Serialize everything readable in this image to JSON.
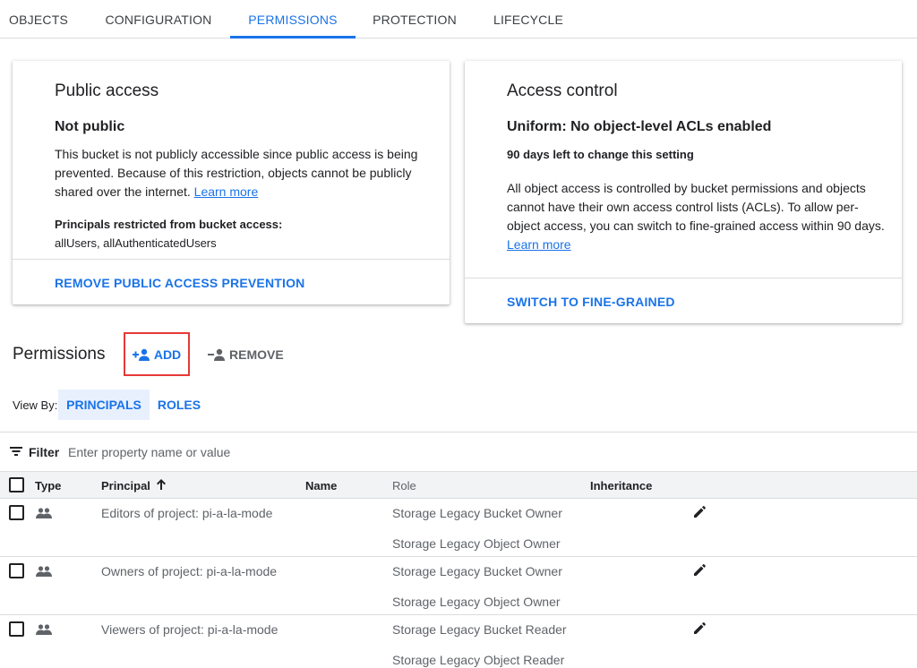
{
  "tabs": [
    {
      "label": "OBJECTS"
    },
    {
      "label": "CONFIGURATION"
    },
    {
      "label": "PERMISSIONS"
    },
    {
      "label": "PROTECTION"
    },
    {
      "label": "LIFECYCLE"
    }
  ],
  "public_access": {
    "title": "Public access",
    "status": "Not public",
    "description": "This bucket is not publicly accessible since public access is being prevented. Because of this restriction, objects cannot be publicly shared over the internet.",
    "learn_more": "Learn more",
    "principals_label": "Principals restricted from bucket access:",
    "principals_value": "allUsers, allAuthenticatedUsers",
    "action": "REMOVE PUBLIC ACCESS PREVENTION"
  },
  "access_control": {
    "title": "Access control",
    "status": "Uniform: No object-level ACLs enabled",
    "days_left": "90 days left to change this setting",
    "description": "All object access is controlled by bucket permissions and objects cannot have their own access control lists (ACLs). To allow per-object access, you can switch to fine-grained access within 90 days.",
    "learn_more": "Learn more",
    "action": "SWITCH TO FINE-GRAINED"
  },
  "permissions": {
    "title": "Permissions",
    "add_label": "ADD",
    "remove_label": "REMOVE",
    "view_by_label": "View By:",
    "view_principals": "PRINCIPALS",
    "view_roles": "ROLES"
  },
  "filter": {
    "label": "Filter",
    "placeholder": "Enter property name or value"
  },
  "table": {
    "columns": {
      "type": "Type",
      "principal": "Principal",
      "name": "Name",
      "role": "Role",
      "inheritance": "Inheritance"
    },
    "rows": [
      {
        "principal": "Editors of project: pi-a-la-mode",
        "role1": "Storage Legacy Bucket Owner",
        "role2": "Storage Legacy Object Owner"
      },
      {
        "principal": "Owners of project: pi-a-la-mode",
        "role1": "Storage Legacy Bucket Owner",
        "role2": "Storage Legacy Object Owner"
      },
      {
        "principal": "Viewers of project: pi-a-la-mode",
        "role1": "Storage Legacy Bucket Reader",
        "role2": "Storage Legacy Object Reader"
      }
    ]
  },
  "colors": {
    "accent": "#1a73e8",
    "highlight_border": "#e53935",
    "selected_bg": "#e8f0fe"
  },
  "icons": {
    "add": "person-add-icon",
    "remove": "person-remove-icon",
    "filter": "filter-list-icon",
    "sort": "arrow-upward-icon",
    "group": "group-icon",
    "edit": "pencil-edit-icon"
  }
}
